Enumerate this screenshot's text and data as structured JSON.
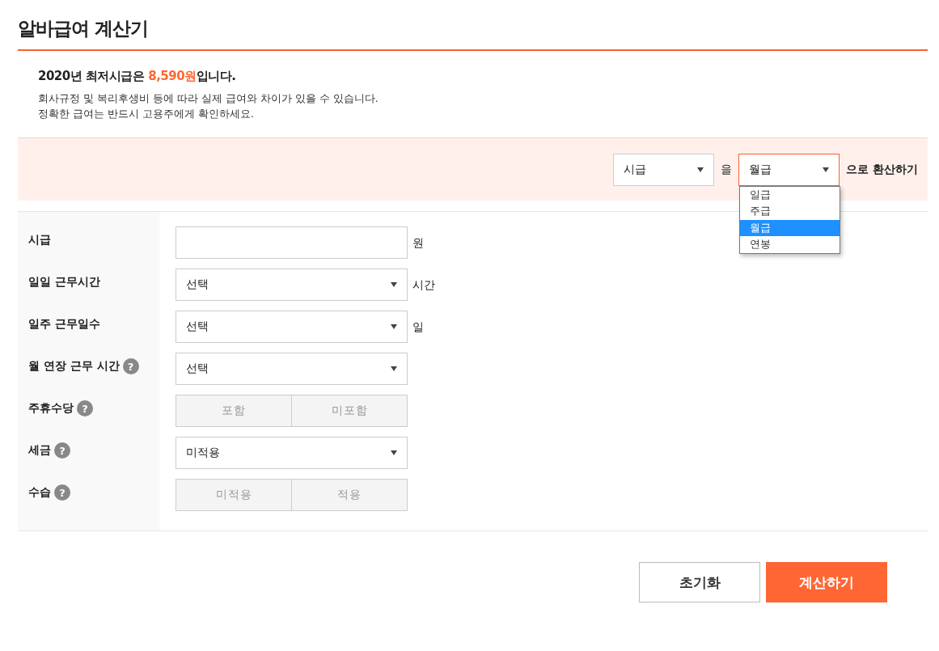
{
  "title": "알바급여 계산기",
  "notice": {
    "headline": "2020년 최저시급은 **8,590원**입니다.",
    "lines": [
      "회사규정 및 복리후생비 등에 따라 실제 급여와 차이가 있을 수 있습니다.",
      "정확한 급여는 반드시 고용주에게 확인하세요."
    ]
  },
  "convert": {
    "from": "시급",
    "particle": "을",
    "to": "월급",
    "suffix": "으로 환산하기",
    "to_expanded": true,
    "options": [
      {
        "label": "일급",
        "selected": false
      },
      {
        "label": "주급",
        "selected": false
      },
      {
        "label": "월급",
        "selected": true
      },
      {
        "label": "연봉",
        "selected": false
      }
    ]
  },
  "rows": [
    {
      "kind": "input",
      "label": "시급",
      "unit": "원"
    },
    {
      "kind": "select",
      "label": "일일 근무시간",
      "value": "선택",
      "unit": "시간"
    },
    {
      "kind": "select",
      "label": "일주 근무일수",
      "value": "선택",
      "unit": "일"
    },
    {
      "kind": "select",
      "label": "월 연장 근무 시간",
      "help": "?",
      "value": "선택"
    },
    {
      "kind": "toggle",
      "label": "주휴수당",
      "help": "?",
      "options": [
        {
          "label": "포함",
          "selected": false
        },
        {
          "label": "미포함",
          "selected": false
        }
      ]
    },
    {
      "kind": "select",
      "label": "세금",
      "help": "?",
      "value": "미적용"
    },
    {
      "kind": "toggle",
      "label": "수습",
      "help": "?",
      "options": [
        {
          "label": "미적용",
          "selected": false
        },
        {
          "label": "적용",
          "selected": false
        }
      ]
    }
  ],
  "buttons": [
    {
      "label": "초기화",
      "kind": "secondary"
    },
    {
      "label": "계산하기",
      "kind": "primary"
    }
  ]
}
